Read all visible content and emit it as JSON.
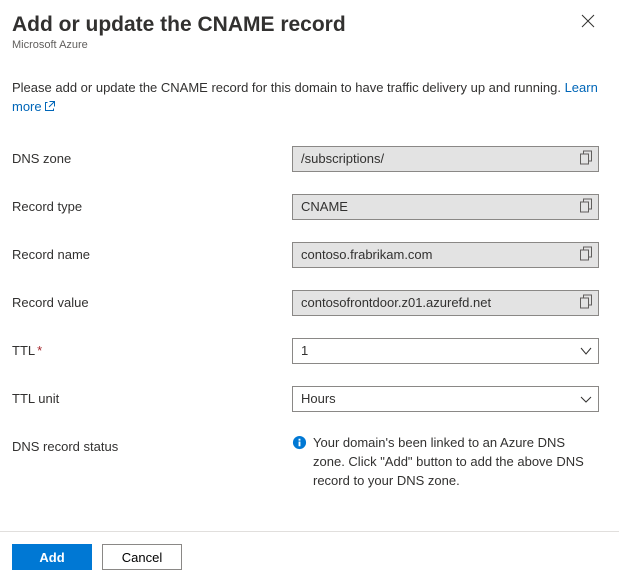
{
  "header": {
    "title": "Add or update the CNAME record",
    "subtitle": "Microsoft Azure"
  },
  "intro": {
    "text_before": "Please add or update the CNAME record for this domain to have traffic delivery up and running. ",
    "link_text": "Learn more"
  },
  "fields": {
    "dns_zone": {
      "label": "DNS zone",
      "value": "/subscriptions/"
    },
    "record_type": {
      "label": "Record type",
      "value": "CNAME"
    },
    "record_name": {
      "label": "Record name",
      "value": "contoso.frabrikam.com"
    },
    "record_value": {
      "label": "Record value",
      "value": "contosofrontdoor.z01.azurefd.net"
    },
    "ttl": {
      "label": "TTL",
      "value": "1"
    },
    "ttl_unit": {
      "label": "TTL unit",
      "value": "Hours"
    },
    "status": {
      "label": "DNS record status",
      "message": "Your domain's been linked to an Azure DNS zone. Click \"Add\" button to add the above DNS record to your DNS zone."
    }
  },
  "footer": {
    "primary": "Add",
    "secondary": "Cancel"
  }
}
